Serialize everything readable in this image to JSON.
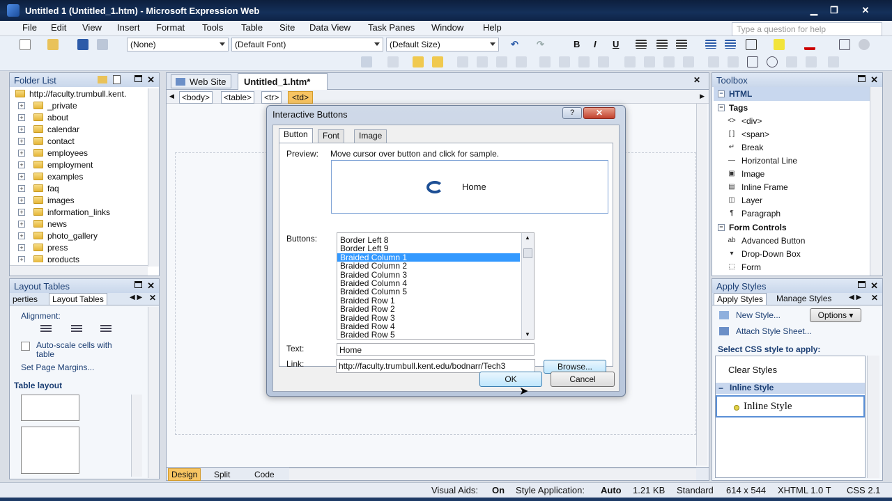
{
  "window": {
    "title": "Untitled 1 (Untitled_1.htm) - Microsoft Expression Web"
  },
  "menu": [
    "File",
    "Edit",
    "View",
    "Insert",
    "Format",
    "Tools",
    "Table",
    "Site",
    "Data View",
    "Task Panes",
    "Window",
    "Help"
  ],
  "help_placeholder": "Type a question for help",
  "toolbar": {
    "style": "(None)",
    "font": "(Default Font)",
    "size": "(Default Size)",
    "bold": "B",
    "italic": "I",
    "underline": "U"
  },
  "folder_list": {
    "title": "Folder List",
    "root": "http://faculty.trumbull.kent.",
    "folders": [
      "_private",
      "about",
      "calendar",
      "contact",
      "employees",
      "employment",
      "examples",
      "faq",
      "images",
      "information_links",
      "news",
      "photo_gallery",
      "press",
      "products"
    ]
  },
  "layout_tables": {
    "title": "Layout Tables",
    "tab_properties": "perties",
    "tab_layout": "Layout Tables",
    "alignment_label": "Alignment:",
    "autoscale": "Auto-scale cells with table",
    "set_margins": "Set Page Margins...",
    "table_layout": "Table layout"
  },
  "doc_tabs": {
    "website": "Web Site",
    "file": "Untitled_1.htm*"
  },
  "breadcrumb": [
    "<body>",
    "<table>",
    "<tr>",
    "<td>"
  ],
  "view_tabs": {
    "design": "Design",
    "split": "Split",
    "code": "Code"
  },
  "toolbox": {
    "title": "Toolbox",
    "html": "HTML",
    "tags_header": "Tags",
    "tags": [
      {
        "g": "<>",
        "label": "<div>"
      },
      {
        "g": "[ ]",
        "label": "<span>"
      },
      {
        "g": "↵",
        "label": "Break"
      },
      {
        "g": "—",
        "label": "Horizontal Line"
      },
      {
        "g": "▣",
        "label": "Image"
      },
      {
        "g": "▤",
        "label": "Inline Frame"
      },
      {
        "g": "◫",
        "label": "Layer"
      },
      {
        "g": "¶",
        "label": "Paragraph"
      }
    ],
    "form_header": "Form Controls",
    "forms": [
      {
        "g": "ab",
        "label": "Advanced Button"
      },
      {
        "g": "▾",
        "label": "Drop-Down Box"
      },
      {
        "g": "⬚",
        "label": "Form"
      }
    ]
  },
  "apply_styles": {
    "title": "Apply Styles",
    "tab1": "Apply Styles",
    "tab2": "Manage Styles",
    "new_style": "New Style...",
    "options": "Options",
    "attach": "Attach Style Sheet...",
    "select_label": "Select CSS style to apply:",
    "clear": "Clear Styles",
    "inline_header": "Inline Style",
    "inline_item": "Inline Style"
  },
  "dialog": {
    "title": "Interactive Buttons",
    "tabs": [
      "Button",
      "Font",
      "Image"
    ],
    "preview_label": "Preview:",
    "preview_hint": "Move cursor over button and click for sample.",
    "preview_text": "Home",
    "buttons_label": "Buttons:",
    "buttons": [
      "Border Left 8",
      "Border Left 9",
      "Braided Column 1",
      "Braided Column 2",
      "Braided Column 3",
      "Braided Column 4",
      "Braided Column 5",
      "Braided Row 1",
      "Braided Row 2",
      "Braided Row 3",
      "Braided Row 4",
      "Braided Row 5"
    ],
    "selected": "Braided Column 1",
    "text_label": "Text:",
    "text_value": "Home",
    "link_label": "Link:",
    "link_value": "http://faculty.trumbull.kent.edu/bodnarr/Tech3",
    "browse": "Browse...",
    "ok": "OK",
    "cancel": "Cancel"
  },
  "status": {
    "visual_aids_label": "Visual Aids:",
    "visual_aids": "On",
    "style_app_label": "Style Application:",
    "style_app": "Auto",
    "size": "1.21 KB",
    "mode": "Standard",
    "dims": "614 x 544",
    "doctype": "XHTML 1.0 T",
    "css": "CSS 2.1"
  }
}
